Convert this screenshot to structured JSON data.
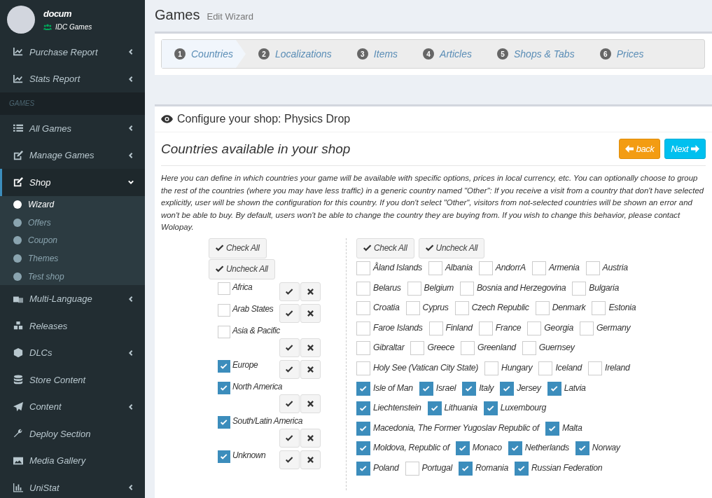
{
  "user": {
    "name": "docum",
    "org": "IDC Games"
  },
  "sidebar": [
    {
      "kind": "item",
      "label": "Purchase Report",
      "expanded": false,
      "selected": false
    },
    {
      "kind": "item",
      "label": "Stats Report",
      "expanded": false,
      "selected": false
    },
    {
      "kind": "header",
      "label": "GAMES"
    },
    {
      "kind": "item",
      "label": "All Games",
      "expanded": false,
      "selected": false
    },
    {
      "kind": "item",
      "label": "Manage Games",
      "expanded": false,
      "selected": false
    },
    {
      "kind": "item",
      "label": "Shop",
      "expanded": true,
      "selected": true,
      "children": [
        {
          "label": "Wizard",
          "selected": true
        },
        {
          "label": "Offers",
          "selected": false
        },
        {
          "label": "Coupon",
          "selected": false
        },
        {
          "label": "Themes",
          "selected": false
        },
        {
          "label": "Test shop",
          "selected": false
        }
      ]
    },
    {
      "kind": "item",
      "label": "Multi-Language",
      "expanded": false,
      "selected": false
    },
    {
      "kind": "item",
      "label": "Releases",
      "selected": false
    },
    {
      "kind": "item",
      "label": "DLCs",
      "expanded": false,
      "selected": false
    },
    {
      "kind": "item",
      "label": "Store Content",
      "selected": false
    },
    {
      "kind": "item",
      "label": "Content",
      "expanded": false,
      "selected": false
    },
    {
      "kind": "item",
      "label": "Deploy Section",
      "selected": false
    },
    {
      "kind": "item",
      "label": "Media Gallery",
      "selected": false
    },
    {
      "kind": "item",
      "label": "UniStat",
      "expanded": false,
      "selected": false
    }
  ],
  "page": {
    "title": "Games",
    "subtitle": "Edit Wizard"
  },
  "steps": [
    {
      "number": "1",
      "label": "Countries",
      "selected": true
    },
    {
      "number": "2",
      "label": "Localizations",
      "selected": false
    },
    {
      "number": "3",
      "label": "Items",
      "selected": false
    },
    {
      "number": "4",
      "label": "Articles",
      "selected": false
    },
    {
      "number": "5",
      "label": "Shops & Tabs",
      "selected": false
    },
    {
      "number": "6",
      "label": "Prices",
      "selected": false
    }
  ],
  "panel": {
    "title": "Configure your shop: Physics Drop",
    "heading": "Countries available in your shop",
    "back_button": "back",
    "next_button": "Next",
    "description": "Here you can define in which countries your game will be available with specific options, prices in local currency, etc. You can optionally choose to group the rest of the countries (where you may have less traffic) in a generic country named \"Other\": If you receive a visit from a country that don't have selected explicitly, user will be shown the configuration for this country. If you don't select \"Other\", visitors from not-selected countries will be shown an error and won't be able to buy. By default, users won't be able to change the country they are buying from. If you wish to change this behavior, please contact Wolopay."
  },
  "regions_check_all": "Check All",
  "regions_uncheck_all": "Uncheck All",
  "regions": [
    {
      "name": "Africa",
      "checked": false
    },
    {
      "name": "Arab States",
      "checked": false
    },
    {
      "name": "Asia & Pacific",
      "checked": false
    },
    {
      "name": "Europe",
      "checked": true
    },
    {
      "name": "North America",
      "checked": true
    },
    {
      "name": "South/Latin America",
      "checked": true
    },
    {
      "name": "Unknown",
      "checked": true
    }
  ],
  "countries_check_all": "Check All",
  "countries_uncheck_all": "Uncheck All",
  "country_rows": [
    [
      {
        "name": "Åland Islands",
        "checked": false
      },
      {
        "name": "Albania",
        "checked": false
      },
      {
        "name": "AndorrA",
        "checked": false
      },
      {
        "name": "Armenia",
        "checked": false
      },
      {
        "name": "Austria",
        "checked": false
      }
    ],
    [
      {
        "name": "Belarus",
        "checked": false
      },
      {
        "name": "Belgium",
        "checked": false
      },
      {
        "name": "Bosnia and Herzegovina",
        "checked": false
      },
      {
        "name": "Bulgaria",
        "checked": false
      }
    ],
    [
      {
        "name": "Croatia",
        "checked": false
      },
      {
        "name": "Cyprus",
        "checked": false
      },
      {
        "name": "Czech Republic",
        "checked": false
      },
      {
        "name": "Denmark",
        "checked": false
      },
      {
        "name": "Estonia",
        "checked": false
      }
    ],
    [
      {
        "name": "Faroe Islands",
        "checked": false
      },
      {
        "name": "Finland",
        "checked": false
      },
      {
        "name": "France",
        "checked": false
      },
      {
        "name": "Georgia",
        "checked": false
      },
      {
        "name": "Germany",
        "checked": false
      }
    ],
    [
      {
        "name": "Gibraltar",
        "checked": false
      },
      {
        "name": "Greece",
        "checked": false
      },
      {
        "name": "Greenland",
        "checked": false
      },
      {
        "name": "Guernsey",
        "checked": false
      }
    ],
    [
      {
        "name": "Holy See (Vatican City State)",
        "checked": false
      },
      {
        "name": "Hungary",
        "checked": false
      },
      {
        "name": "Iceland",
        "checked": false
      },
      {
        "name": "Ireland",
        "checked": false
      }
    ],
    [
      {
        "name": "Isle of Man",
        "checked": true
      },
      {
        "name": "Israel",
        "checked": true
      },
      {
        "name": "Italy",
        "checked": true
      },
      {
        "name": "Jersey",
        "checked": true
      },
      {
        "name": "Latvia",
        "checked": true
      }
    ],
    [
      {
        "name": "Liechtenstein",
        "checked": true
      },
      {
        "name": "Lithuania",
        "checked": true
      },
      {
        "name": "Luxembourg",
        "checked": true
      }
    ],
    [
      {
        "name": "Macedonia, The Former Yugoslav Republic of",
        "checked": true
      },
      {
        "name": "Malta",
        "checked": true
      }
    ],
    [
      {
        "name": "Moldova, Republic of",
        "checked": true
      },
      {
        "name": "Monaco",
        "checked": true
      },
      {
        "name": "Netherlands",
        "checked": true
      },
      {
        "name": "Norway",
        "checked": true
      }
    ],
    [
      {
        "name": "Poland",
        "checked": true
      },
      {
        "name": "Portugal",
        "checked": false
      },
      {
        "name": "Romania",
        "checked": true
      },
      {
        "name": "Russian Federation",
        "checked": true
      }
    ]
  ]
}
